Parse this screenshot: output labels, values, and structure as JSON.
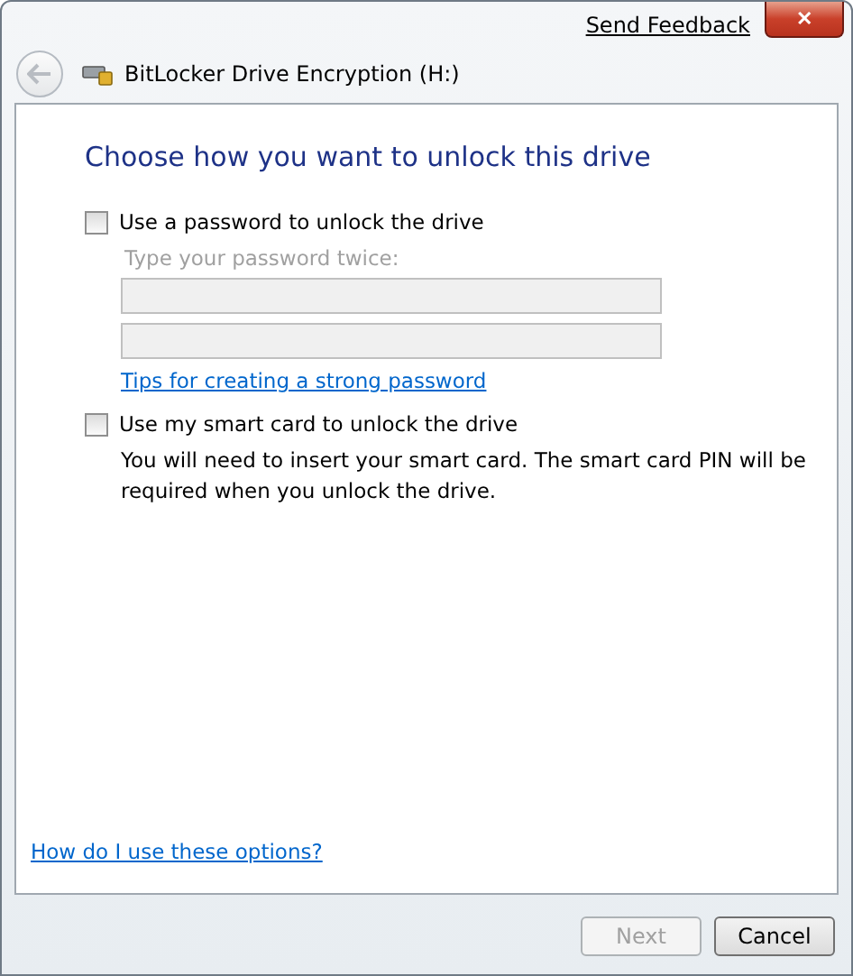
{
  "window": {
    "title": "BitLocker Drive Encryption (H:)",
    "feedback_link": "Send Feedback",
    "close": "✕"
  },
  "heading": "Choose how you want to unlock this drive",
  "options": [
    {
      "kind": "password",
      "label": "Use a password to unlock the drive",
      "checked": false,
      "hint": "Type your password twice:",
      "fields_disabled": true,
      "fields": [
        {
          "kind": "password"
        },
        {
          "kind": "password"
        }
      ],
      "link": "Tips for creating a strong password"
    },
    {
      "kind": "smartcard",
      "label": "Use my smart card to unlock the drive",
      "checked": false,
      "description": "You will need to insert your smart card. The smart card PIN will be required when you unlock the drive."
    }
  ],
  "help_link": "How do I use these options?",
  "buttons": [
    {
      "label": "Next",
      "disabled": true
    },
    {
      "label": "Cancel",
      "disabled": false
    }
  ]
}
